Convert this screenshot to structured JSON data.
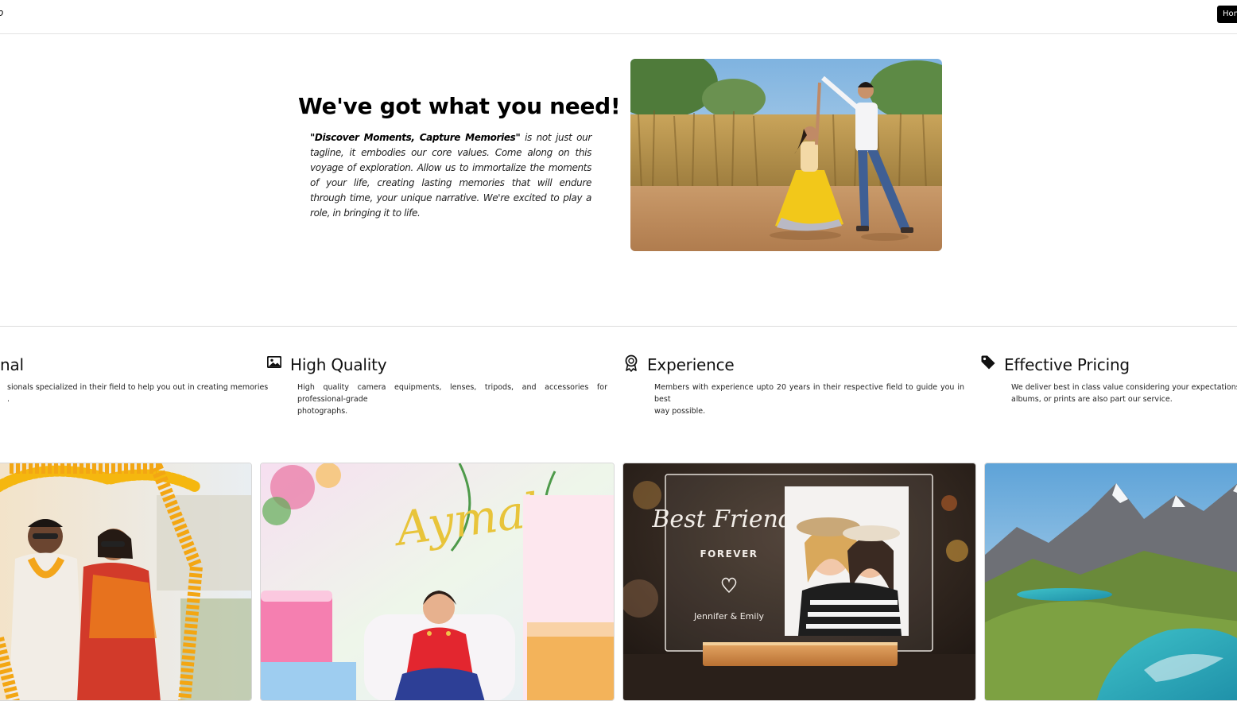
{
  "navbar": {
    "brand": "dio",
    "home_label": "Home"
  },
  "hero": {
    "title": "We've got what you need!",
    "tagline": "\"Discover Moments, Capture Memories\"",
    "body": " is not just our tagline, it embodies our core values. Come along on this voyage of exploration. Allow us to immortalize the moments of your life, creating lasting memories that will endure through time, your unique narrative. We're excited to play a role, in bringing it to life.",
    "image_icon": "couple-dancing-photo"
  },
  "features": [
    {
      "title": "nal",
      "text": "sionals specialized in their field to help you out in creating memories",
      "text2": ".",
      "icon": "person-icon"
    },
    {
      "title": "High Quality",
      "text": "High quality camera equipments, lenses, tripods, and accessories for professional-grade",
      "text2": "photographs.",
      "icon": "image-icon"
    },
    {
      "title": "Experience",
      "text": "Members with experience upto 20 years in their respective field to guide you in best",
      "text2": "way possible.",
      "icon": "award-icon"
    },
    {
      "title": "Effective Pricing",
      "text": "We deliver best in class value considering your expectations",
      "text2": "albums, or prints are also part our service.",
      "icon": "tag-icon"
    }
  ],
  "gallery": {
    "card2_text": "Aymala",
    "card3_title": "Best Friends",
    "card3_subtitle": "FOREVER",
    "card3_names": "Jennifer & Emily"
  }
}
